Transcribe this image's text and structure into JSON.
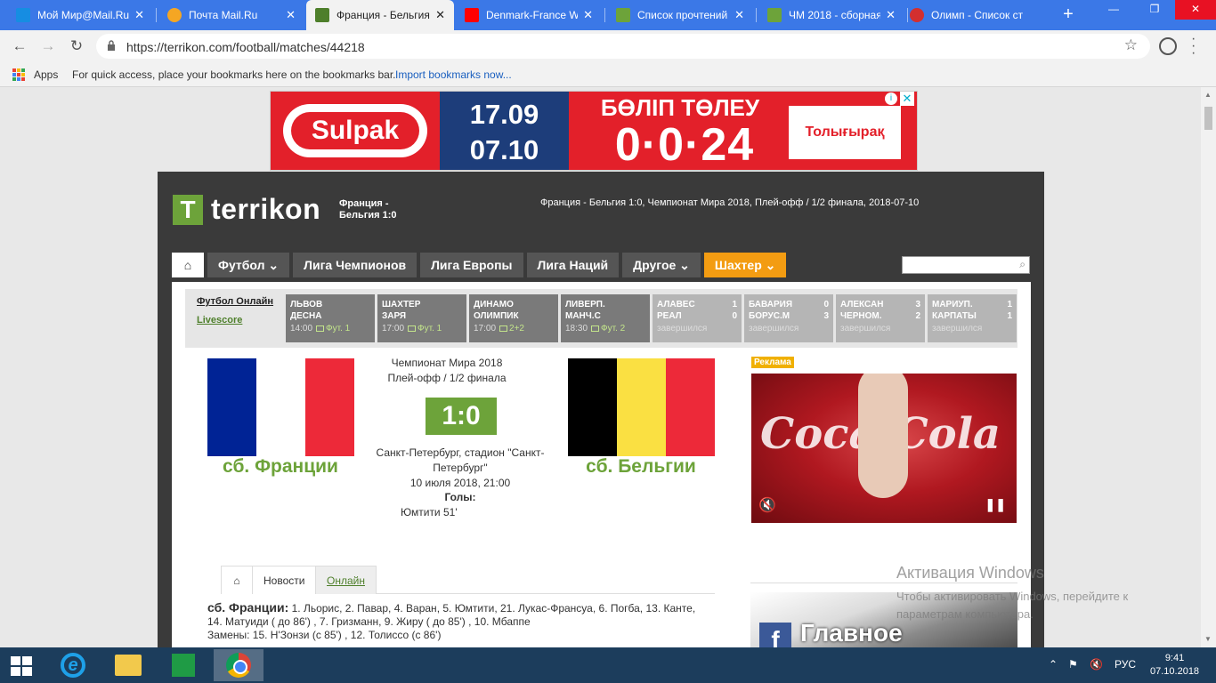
{
  "browser": {
    "tabs": [
      {
        "title": "Мой Мир@Mail.Ru",
        "favicon_color": "#168de2"
      },
      {
        "title": "Почта Mail.Ru",
        "favicon_color": "#f5a623"
      },
      {
        "title": "Франция - Бельгия",
        "favicon_color": "#4e7f2b"
      },
      {
        "title": "Denmark-France W",
        "favicon_color": "#ff0000"
      },
      {
        "title": "Список прочтений",
        "favicon_color": "#6da33a"
      },
      {
        "title": "ЧМ 2018 - сборная",
        "favicon_color": "#6da33a"
      },
      {
        "title": "Олимп - Список ст",
        "favicon_color": "#d32f2f"
      }
    ],
    "url": "https://terrikon.com/football/matches/44218",
    "bookmarks": {
      "apps_label": "Apps",
      "hint": "For quick access, place your bookmarks here on the bookmarks bar.",
      "import_label": "Import bookmarks now..."
    }
  },
  "ad_banner": {
    "brand": "Sulpak",
    "date1": "17.09",
    "date2": "07.10",
    "slogan": "БӨЛІП ТӨЛЕУ",
    "rate": "0·0·24",
    "cta": "Толығырақ",
    "bg_color": "#e3202a"
  },
  "site": {
    "logo_text": "terrikon",
    "match_short_line1": "Франция -",
    "match_short_line2": "Бельгия 1:0",
    "header_info": "Франция - Бельгия 1:0, Чемпионат Мира 2018, Плей-офф / 1/2 финала, 2018-07-10",
    "nav": [
      "Футбол ⌄",
      "Лига Чемпионов",
      "Лига Европы",
      "Лига Наций",
      "Другое ⌄",
      "Шахтер ⌄"
    ],
    "accent_color": "#6da33a"
  },
  "livescore": {
    "link1": "Футбол Онлайн",
    "link2": "Livescore",
    "matches": [
      {
        "home": "ЛЬВОВ",
        "away": "ДЕСНА",
        "home_score": "",
        "away_score": "",
        "time": "14:00",
        "channel": "Фут. 1",
        "status": ""
      },
      {
        "home": "ШАХТЕР",
        "away": "ЗАРЯ",
        "home_score": "",
        "away_score": "",
        "time": "17:00",
        "channel": "Фут. 1",
        "status": ""
      },
      {
        "home": "ДИНАМО",
        "away": "ОЛИМПИК",
        "home_score": "",
        "away_score": "",
        "time": "17:00",
        "channel": "2+2",
        "status": ""
      },
      {
        "home": "ЛИВЕРП.",
        "away": "МАНЧ.С",
        "home_score": "",
        "away_score": "",
        "time": "18:30",
        "channel": "Фут. 2",
        "status": ""
      },
      {
        "home": "АЛАВЕС",
        "away": "РЕАЛ",
        "home_score": "1",
        "away_score": "0",
        "time": "",
        "channel": "",
        "status": "завершился"
      },
      {
        "home": "БАВАРИЯ",
        "away": "БОРУС.М",
        "home_score": "0",
        "away_score": "3",
        "time": "",
        "channel": "",
        "status": "завершился"
      },
      {
        "home": "АЛЕКСАН",
        "away": "ЧЕРНОМ.",
        "home_score": "3",
        "away_score": "2",
        "time": "",
        "channel": "",
        "status": "завершился"
      },
      {
        "home": "МАРИУП.",
        "away": "КАРПАТЫ",
        "home_score": "1",
        "away_score": "1",
        "time": "",
        "channel": "",
        "status": "завершился"
      }
    ]
  },
  "match": {
    "home": "сб. Франции",
    "away": "сб. Бельгии",
    "tournament": "Чемпионат Мира 2018",
    "stage": "Плей-офф / 1/2 финала",
    "score": "1:0",
    "venue": "Санкт-Петербург, стадион \"Санкт-Петербург\"",
    "datetime": "10 июля 2018, 21:00",
    "goals_label": "Голы:",
    "goals": [
      "Юмтити 51'"
    ],
    "home_flag": [
      "#002395",
      "#ffffff",
      "#ed2939"
    ],
    "away_flag": [
      "#000000",
      "#fae042",
      "#ed2939"
    ]
  },
  "sidebar": {
    "ad_label": "Реклама",
    "video_brand": "Coca-Cola",
    "fb_title": "Главное"
  },
  "tabs2": {
    "news": "Новости",
    "online": "Онлайн"
  },
  "lineup": {
    "team": "сб. Франции:",
    "players": "1. Льорис, 2. Павар, 4. Варан, 5. Юмтити, 21. Лукас-Франсуа, 6. Погба, 13. Канте, 14. Матуиди ( до 86') , 7. Гризманн, 9. Жиру ( до 85') , 10. Мбаппе",
    "subs_label": "Замены:",
    "subs": "15. Н'Зонзи (с 85') , 12. Толиссо (с 86')"
  },
  "watermark": {
    "title": "Активация Windows",
    "text": "Чтобы активировать Windows, перейдите к параметрам компьютера."
  },
  "taskbar": {
    "lang": "РУС",
    "time": "9:41",
    "date": "07.10.2018"
  }
}
